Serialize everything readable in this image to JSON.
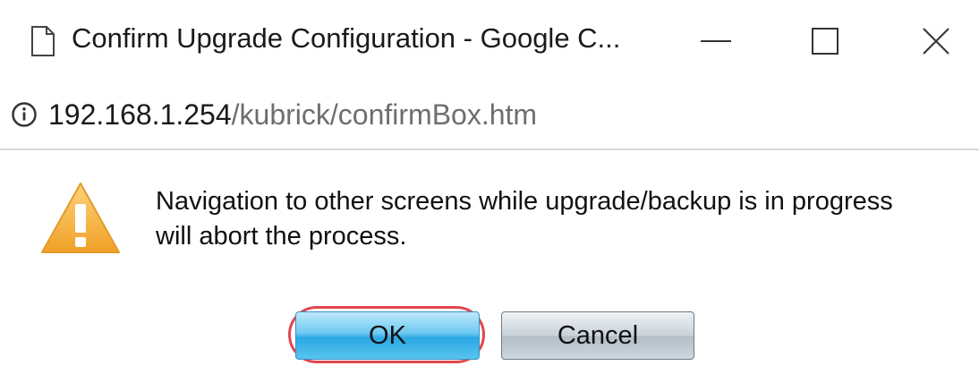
{
  "window": {
    "title": "Confirm Upgrade Configuration - Google C...",
    "controls": {
      "minimize": "minimize-icon",
      "maximize": "maximize-icon",
      "close": "close-icon"
    }
  },
  "address_bar": {
    "icon": "info-icon",
    "url_host": "192.168.1.254",
    "url_path": "/kubrick/confirmBox.htm"
  },
  "dialog": {
    "icon": "warning-icon",
    "message": "Navigation to other screens while upgrade/backup is in progress will abort the process.",
    "ok_label": "OK",
    "cancel_label": "Cancel",
    "highlight_color": "#e0474e"
  }
}
